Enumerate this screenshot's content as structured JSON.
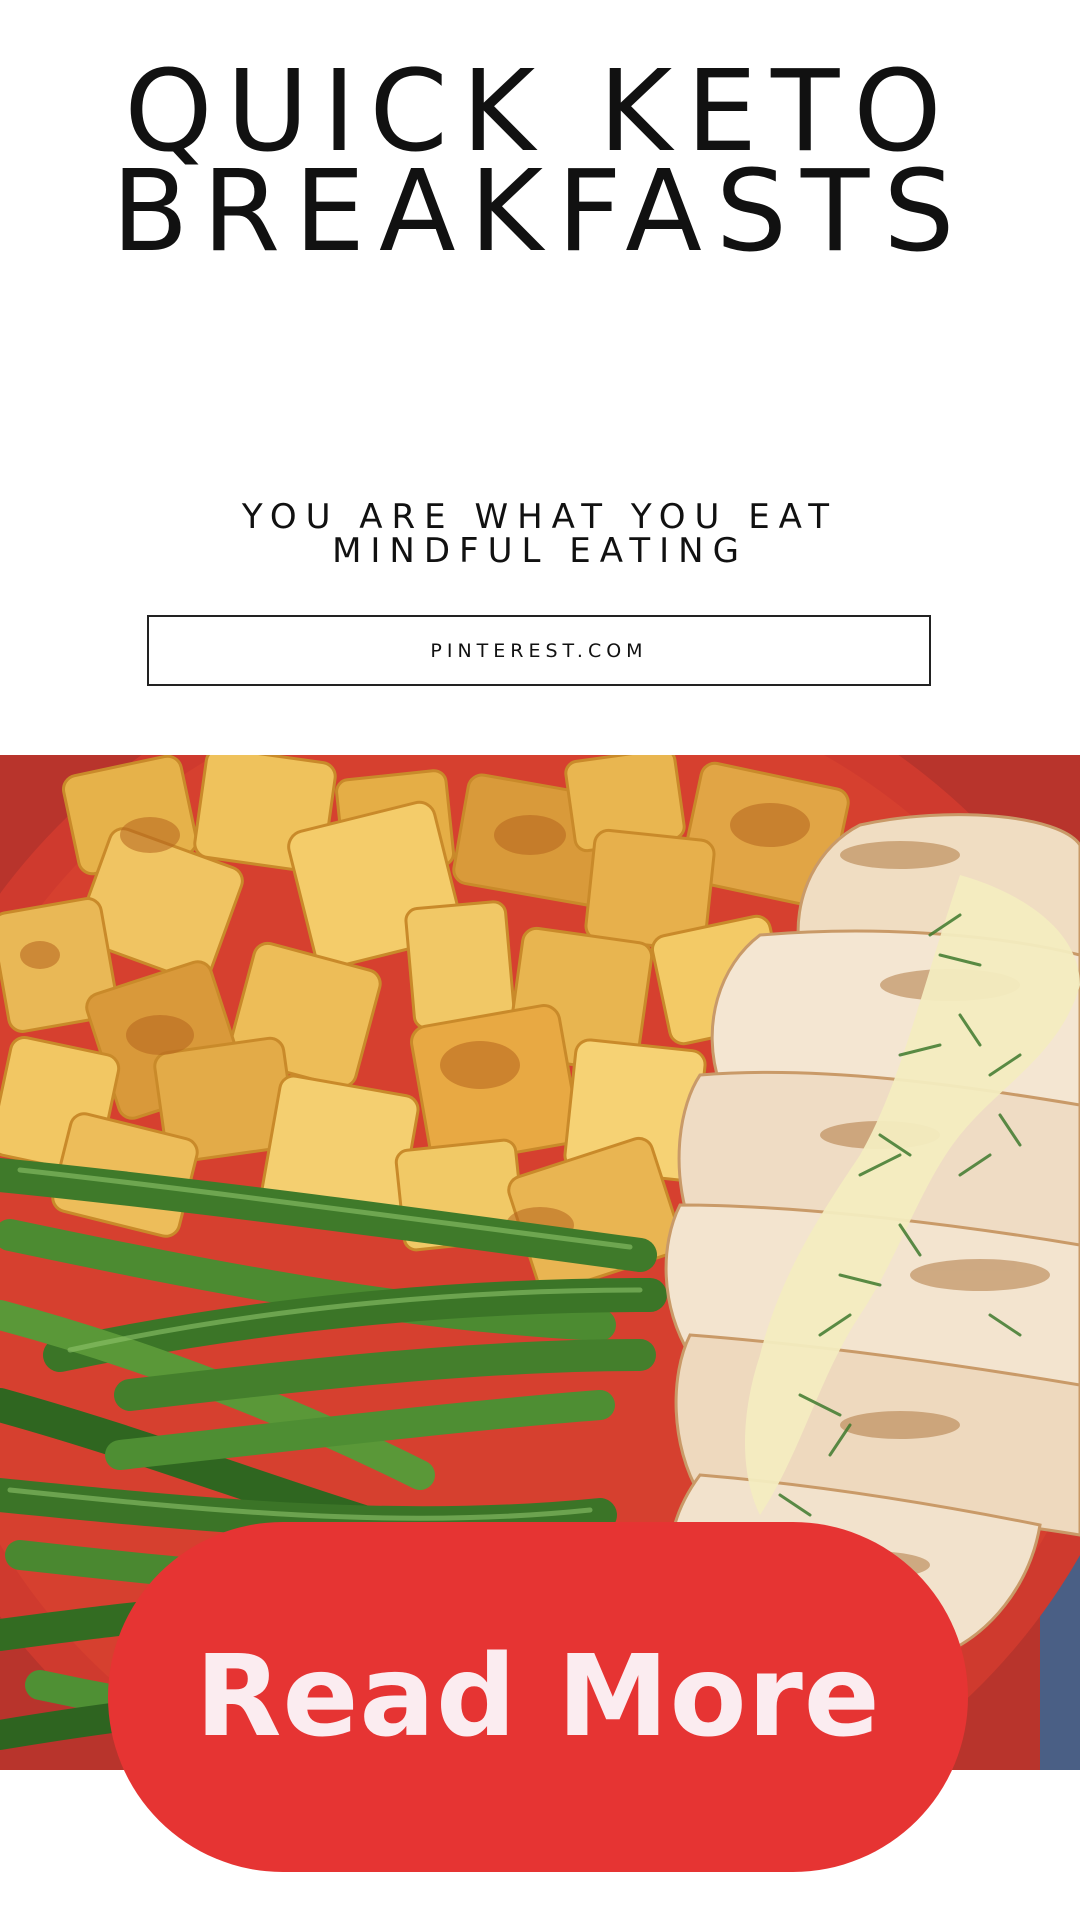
{
  "header": {
    "title_line1": "QUICK KETO",
    "title_line2": "BREAKFASTS"
  },
  "tagline": {
    "line1": "YOU ARE WHAT YOU EAT",
    "line2": "MINDFUL EATING"
  },
  "source": {
    "label": "PINTEREST.COM"
  },
  "photo": {
    "subject": "plate of roasted potatoes, green beans and sliced chicken with dill sauce"
  },
  "cta": {
    "label": "Read More"
  },
  "colors": {
    "accent": "#e63433",
    "cta_text": "#fbecf0",
    "plate": "#c9302a",
    "text": "#111111"
  }
}
